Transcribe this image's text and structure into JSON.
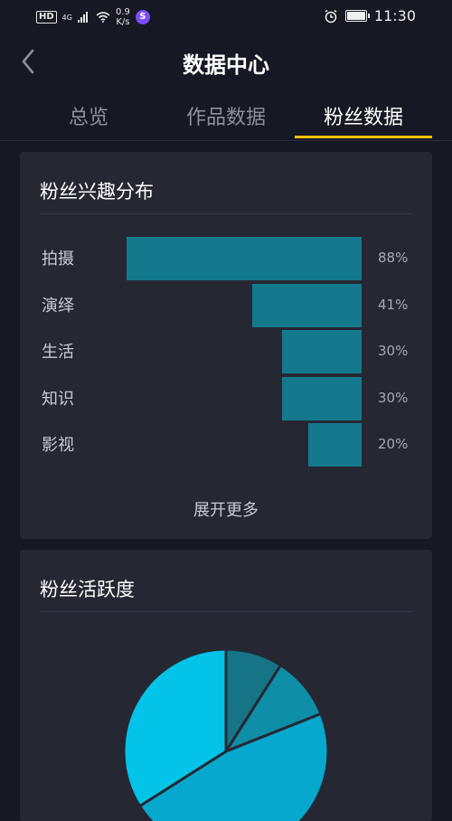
{
  "status_bar": {
    "hd": "HD",
    "network": "4G",
    "speed_value": "0.9",
    "speed_unit": "K/s",
    "app_icon": "soul-app-icon",
    "time": "11:30",
    "battery_level": 1.0
  },
  "nav": {
    "title": "数据中心"
  },
  "tabs": [
    {
      "label": "总览",
      "active": false
    },
    {
      "label": "作品数据",
      "active": false
    },
    {
      "label": "粉丝数据",
      "active": true
    }
  ],
  "interest": {
    "title": "粉丝兴趣分布",
    "expand_label": "展开更多",
    "chart_data": {
      "type": "bar",
      "orientation": "horizontal",
      "categories": [
        "拍摄",
        "演绎",
        "生活",
        "知识",
        "影视"
      ],
      "values": [
        88,
        41,
        30,
        30,
        20
      ],
      "value_labels": [
        "88%",
        "41%",
        "30%",
        "30%",
        "20%"
      ],
      "unit": "%"
    }
  },
  "activity": {
    "title": "粉丝活跃度",
    "chart_data": {
      "type": "pie",
      "slices": [
        {
          "value": 9,
          "color": "#157587"
        },
        {
          "value": 10,
          "color": "#0f8ea7"
        },
        {
          "value": 47,
          "color": "#06a9cd"
        },
        {
          "value": 34,
          "color": "#03c3e8"
        }
      ]
    }
  },
  "colors": {
    "background": "#161823",
    "card": "#252833",
    "bar": "#15798d",
    "accent": "#f5c100"
  }
}
